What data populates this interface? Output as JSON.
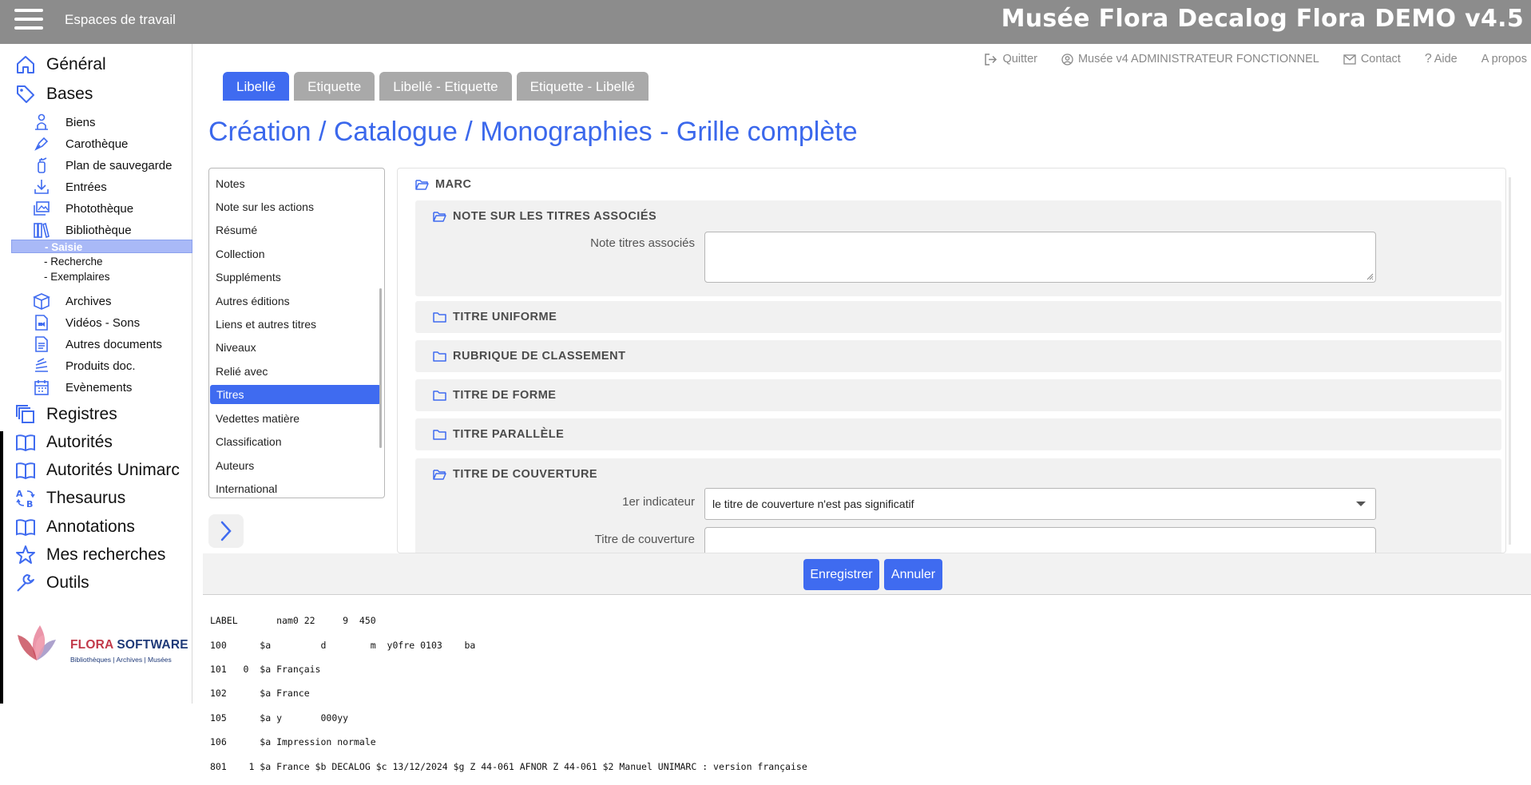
{
  "header": {
    "workspace_label": "Espaces de travail",
    "app_title": "Musée Flora Decalog Flora DEMO v4.5"
  },
  "sidebar": {
    "general": "Général",
    "bases": "Bases",
    "bases_items": [
      "Biens",
      "Carothèque",
      "Plan de sauvegarde",
      "Entrées",
      "Photothèque",
      "Bibliothèque"
    ],
    "bibliotheque_sub": [
      "- Saisie",
      "- Recherche",
      "- Exemplaires"
    ],
    "bases_items2": [
      "Archives",
      "Vidéos - Sons",
      "Autres documents",
      "Produits doc.",
      "Evènements"
    ],
    "top_items": [
      "Registres",
      "Autorités",
      "Autorités Unimarc",
      "Thesaurus",
      "Annotations",
      "Mes recherches",
      "Outils"
    ],
    "logo": {
      "brand_a": "FLORA",
      "brand_b": "SOFTWARE",
      "tagline": "Bibliothèques | Archives | Musées"
    }
  },
  "toplinks": {
    "quit": "Quitter",
    "user": "Musée v4 ADMINISTRATEUR FONCTIONNEL",
    "contact": "Contact",
    "help": "Aide",
    "about": "A propos"
  },
  "tabs": [
    "Libellé",
    "Etiquette",
    "Libellé - Etiquette",
    "Etiquette - Libellé"
  ],
  "page_title": "Création / Catalogue / Monographies - Grille complète",
  "leftlist": {
    "items": [
      "Notes",
      "Note sur les actions",
      "Résumé",
      "Collection",
      "Suppléments",
      "Autres éditions",
      "Liens et autres titres",
      "Niveaux",
      "Relié avec",
      "Titres",
      "Vedettes matière",
      "Classification",
      "Auteurs",
      "International"
    ],
    "selected": "Titres"
  },
  "main": {
    "root": "MARC",
    "sections": {
      "note_titres": {
        "title": "NOTE SUR LES TITRES ASSOCIÉS",
        "field_label": "Note titres associés",
        "value": ""
      },
      "titre_uniforme": "TITRE UNIFORME",
      "rubrique": "RUBRIQUE DE CLASSEMENT",
      "titre_forme": "TITRE DE FORME",
      "titre_parallele": "TITRE PARALLÈLE",
      "titre_couverture": {
        "title": "TITRE DE COUVERTURE",
        "indicator_label": "1er indicateur",
        "indicator_value": "le titre de couverture n'est pas significatif",
        "field_label": "Titre de couverture",
        "value": ""
      }
    }
  },
  "actions": {
    "save": "Enregistrer",
    "cancel": "Annuler"
  },
  "marc_lines": [
    "LABEL       nam0 22     9  450",
    "100      $a         d        m  y0fre 0103    ba",
    "101   0  $a Français",
    "102      $a France",
    "105      $a y       000yy",
    "106      $a Impression normale",
    "801    1 $a France $b DECALOG $c 13/12/2024 $g Z 44-061 AFNOR Z 44-061 $2 Manuel UNIMARC : version française"
  ],
  "colors": {
    "accent": "#3f6bf0",
    "title": "#3b68ec",
    "topbar": "#8c8c8c"
  }
}
